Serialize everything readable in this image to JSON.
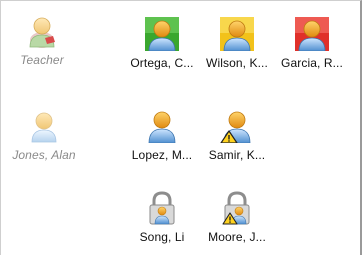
{
  "teacher": {
    "label": "Teacher",
    "icon": "teacher-icon"
  },
  "absent": [
    {
      "label": "Jones, Alan",
      "icon": "student-offline-icon"
    }
  ],
  "students": [
    {
      "label": "Ortega, C...",
      "icon": "student-icon",
      "status": "green"
    },
    {
      "label": "Wilson, K...",
      "icon": "student-icon",
      "status": "yellow"
    },
    {
      "label": "Garcia, R...",
      "icon": "student-icon",
      "status": "red"
    },
    {
      "label": "Lopez, M...",
      "icon": "student-icon",
      "status": "none"
    },
    {
      "label": "Samir, K...",
      "icon": "student-warning-icon",
      "status": "warning"
    },
    {
      "label": "Song, Li",
      "icon": "student-locked-icon",
      "status": "locked"
    },
    {
      "label": "Moore, J...",
      "icon": "student-locked-warning-icon",
      "status": "locked-warning"
    }
  ],
  "colors": {
    "green": "#3aa72e",
    "yellow": "#f2c21a",
    "red": "#e0302a",
    "figure_head": "#f3a51a",
    "figure_body": "#4f8fd0"
  }
}
